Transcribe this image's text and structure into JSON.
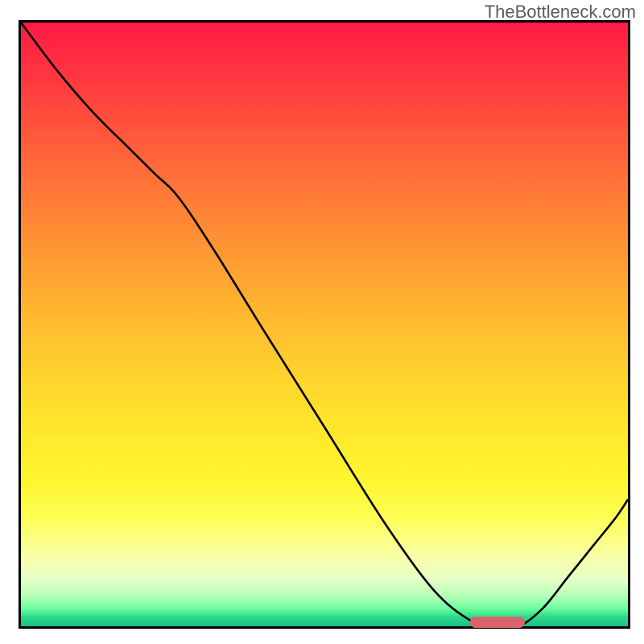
{
  "watermark": "TheBottleneck.com",
  "chart_data": {
    "type": "line",
    "title": "",
    "xlabel": "",
    "ylabel": "",
    "xlim": [
      0,
      100
    ],
    "ylim": [
      0,
      100
    ],
    "grid": false,
    "legend": false,
    "fill_gradient": {
      "direction": "vertical",
      "stops": [
        {
          "pos": 0.0,
          "color": "#ff1a44"
        },
        {
          "pos": 0.22,
          "color": "#ff643a"
        },
        {
          "pos": 0.46,
          "color": "#ffb130"
        },
        {
          "pos": 0.68,
          "color": "#ffe82c"
        },
        {
          "pos": 0.88,
          "color": "#faffa3"
        },
        {
          "pos": 0.97,
          "color": "#6effa0"
        },
        {
          "pos": 1.0,
          "color": "#1abf89"
        }
      ]
    },
    "series": [
      {
        "name": "curve",
        "x": [
          0,
          6,
          12,
          18,
          22,
          26,
          32,
          40,
          50,
          60,
          68,
          74,
          78,
          82,
          86,
          90,
          94,
          98,
          100
        ],
        "y": [
          100,
          92,
          85,
          79,
          75,
          71,
          62,
          49,
          33,
          17,
          6,
          1,
          0,
          0,
          3,
          8,
          13,
          18,
          21
        ]
      }
    ],
    "marker": {
      "x_start": 74,
      "x_end": 83,
      "y": 0.7,
      "color": "#d9636c"
    }
  }
}
